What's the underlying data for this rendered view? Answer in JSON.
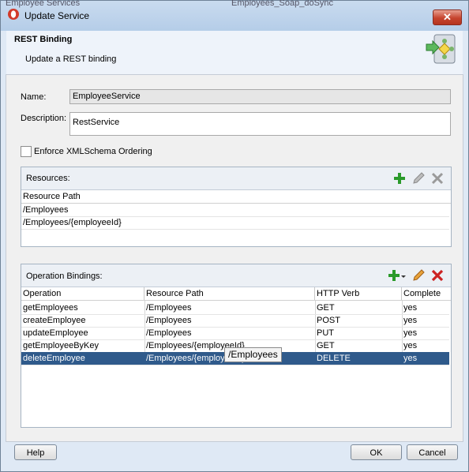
{
  "window": {
    "title": "Update Service",
    "background_text_left": "Employee Services",
    "background_text_right": "Employees_Soap_doSync"
  },
  "header": {
    "title": "REST Binding",
    "subtitle": "Update a REST binding",
    "icon": "rest-binding-wizard-icon"
  },
  "form": {
    "name_label": "Name:",
    "name_value": "EmployeeService",
    "description_label": "Description:",
    "description_value": "RestService",
    "enforce_label": "Enforce XMLSchema Ordering",
    "enforce_checked": false
  },
  "resources": {
    "title": "Resources:",
    "column_header": "Resource Path",
    "rows": [
      "/Employees",
      "/Employees/{employeeId}"
    ]
  },
  "operations": {
    "title": "Operation Bindings:",
    "columns": [
      "Operation",
      "Resource Path",
      "HTTP Verb",
      "Complete"
    ],
    "rows": [
      {
        "operation": "getEmployees",
        "path": "/Employees",
        "verb": "GET",
        "complete": "yes"
      },
      {
        "operation": "createEmployee",
        "path": "/Employees",
        "verb": "POST",
        "complete": "yes"
      },
      {
        "operation": "updateEmployee",
        "path": "/Employees",
        "verb": "PUT",
        "complete": "yes"
      },
      {
        "operation": "getEmployeeByKey",
        "path": "/Employees/{employeeId}",
        "verb": "GET",
        "complete": "yes"
      },
      {
        "operation": "deleteEmployee",
        "path": "/Employees/{employeeId}",
        "verb": "DELETE",
        "complete": "yes"
      }
    ],
    "selected_index": 4,
    "tooltip": "/Employees"
  },
  "buttons": {
    "help": "Help",
    "ok": "OK",
    "cancel": "Cancel"
  },
  "colors": {
    "titlebar": "#b5cde8",
    "selection": "#2f5a8b",
    "add_green": "#2a9a2a",
    "delete_red": "#cc2222",
    "edit_orange": "#d9822b"
  }
}
